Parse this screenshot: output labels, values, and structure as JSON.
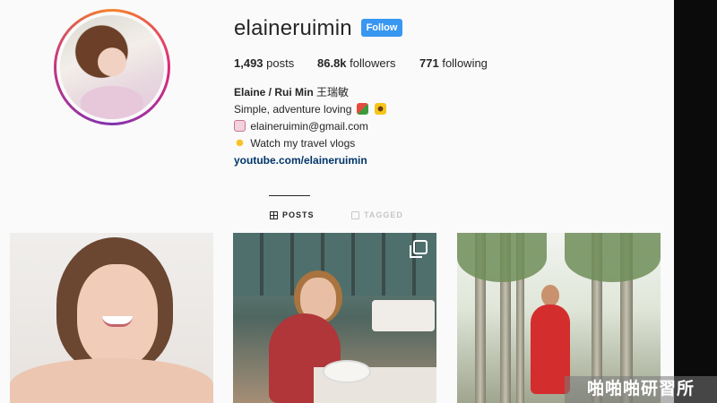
{
  "profile": {
    "username": "elaineruimin",
    "follow_label": "Follow",
    "stats": {
      "posts_count": "1,493",
      "posts_label": "posts",
      "followers_count": "86.8k",
      "followers_label": "followers",
      "following_count": "771",
      "following_label": "following"
    },
    "bio": {
      "name": "Elaine / Rui Min",
      "name_cjk": "王瑞敏",
      "line1": "Simple, adventure loving",
      "email": "elaineruimin@gmail.com",
      "line3": "Watch my travel vlogs",
      "link": "youtube.com/elaineruimin"
    }
  },
  "tabs": [
    {
      "label": "POSTS",
      "active": true
    },
    {
      "label": "TAGGED",
      "active": false
    }
  ],
  "posts": [
    {
      "kind": "single"
    },
    {
      "kind": "multiple"
    },
    {
      "kind": "single"
    }
  ],
  "watermark": "啪啪啪研習所",
  "colors": {
    "follow_button": "#3897f0",
    "link": "#003569",
    "text": "#262626"
  },
  "icons": [
    "grid-icon",
    "tag-icon",
    "multiple-posts-icon",
    "watermelon-emoji-icon",
    "sunflower-emoji-icon",
    "envelope-emoji-icon",
    "sparkle-emoji-icon"
  ]
}
